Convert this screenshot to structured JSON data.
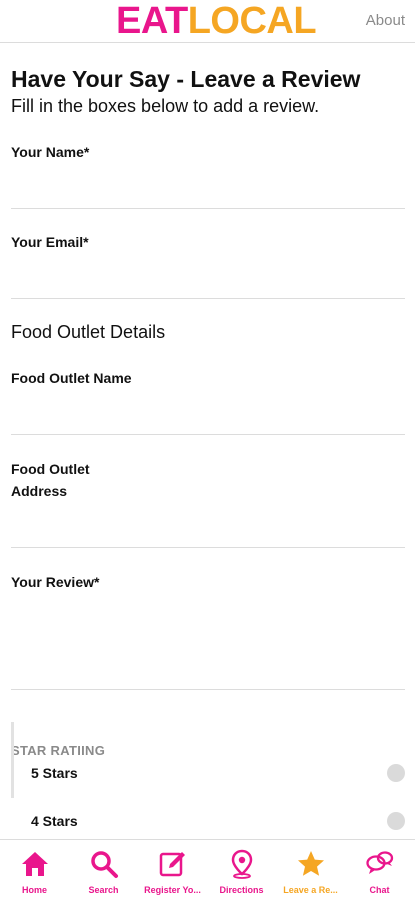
{
  "header": {
    "logo_part1": "EAT",
    "logo_part2": "LOCAL",
    "about_label": "About"
  },
  "form": {
    "title": "Have Your Say - Leave a Review",
    "subtitle": "Fill in the boxes below to add a review.",
    "name_label": "Your Name*",
    "email_label": "Your Email*",
    "outlet_section": "Food Outlet Details",
    "outlet_name_label": "Food Outlet Name",
    "outlet_address_label": "Food Outlet Address",
    "review_label": "Your Review*",
    "star_heading": "STAR RATIING",
    "star_options": [
      "5 Stars",
      "4 Stars"
    ]
  },
  "tabs": [
    {
      "label": "Home",
      "icon": "home-icon"
    },
    {
      "label": "Search",
      "icon": "search-icon"
    },
    {
      "label": "Register Yo...",
      "icon": "edit-icon"
    },
    {
      "label": "Directions",
      "icon": "map-pin-icon"
    },
    {
      "label": "Leave a Re...",
      "icon": "star-icon",
      "active": true
    },
    {
      "label": "Chat",
      "icon": "chat-icon"
    }
  ],
  "colors": {
    "brand_pink": "#e9168c",
    "brand_orange": "#f5a623"
  }
}
